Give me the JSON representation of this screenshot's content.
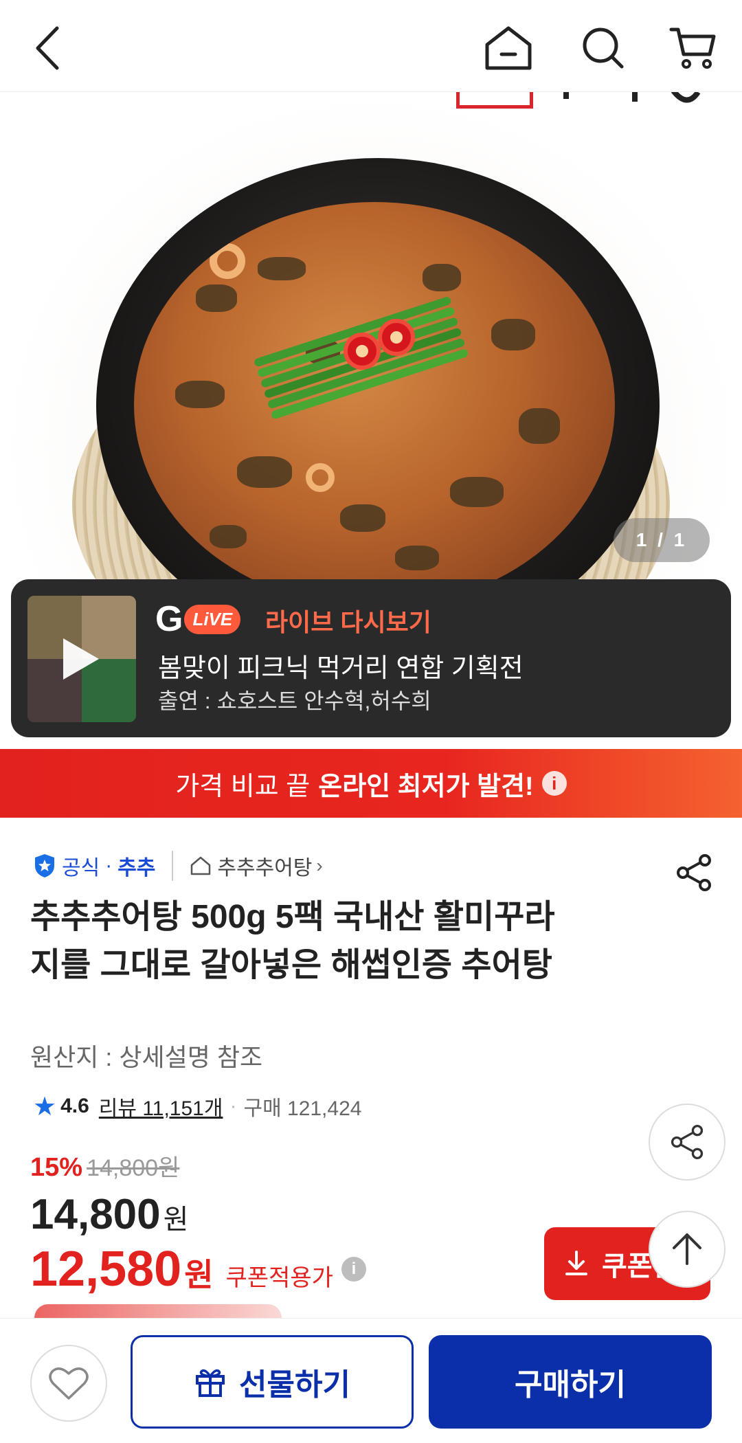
{
  "header": {
    "back_icon": "chevron-left-icon",
    "home_icon": "home-icon",
    "search_icon": "search-icon",
    "cart_icon": "cart-icon"
  },
  "gallery": {
    "page_indicator": "1 / 1"
  },
  "live": {
    "logo_g": "G",
    "logo_live": "LiVE",
    "title": "라이브 다시보기",
    "subtitle": "봄맞이 피크닉 먹거리 연합 기획전",
    "cast": "출연 : 쇼호스트 안수혁,허수희"
  },
  "compare_banner": {
    "text_normal": "가격 비교 끝",
    "text_bold": "온라인 최저가 발견!",
    "info_glyph": "i"
  },
  "brand": {
    "official": "공식",
    "dot": "·",
    "name": "추추",
    "store": "추추추어탕",
    "chevron": "›"
  },
  "product": {
    "title": "추추추어탕 500g 5팩 국내산 활미꾸라지를 그대로 갈아넣은 해썹인증 추어탕",
    "origin": "원산지 : 상세설명 참조",
    "rating": "4.6",
    "reviews": "리뷰 11,151개",
    "purchases_sep": "·",
    "purchases": "구매 121,424"
  },
  "pricing": {
    "discount_rate": "15%",
    "original_price": "14,800원",
    "price": "14,800",
    "price_unit": "원",
    "coupon_price": "12,580",
    "coupon_unit": "원",
    "coupon_label": "쿠폰적용가",
    "coupon_button": "쿠폰받",
    "info_glyph": "i"
  },
  "bottom_bar": {
    "gift_label": "선물하기",
    "buy_label": "구매하기"
  },
  "colors": {
    "brand_blue": "#0b2fa8",
    "sale_red": "#e2221e",
    "live_accent": "#ff6b4a"
  }
}
